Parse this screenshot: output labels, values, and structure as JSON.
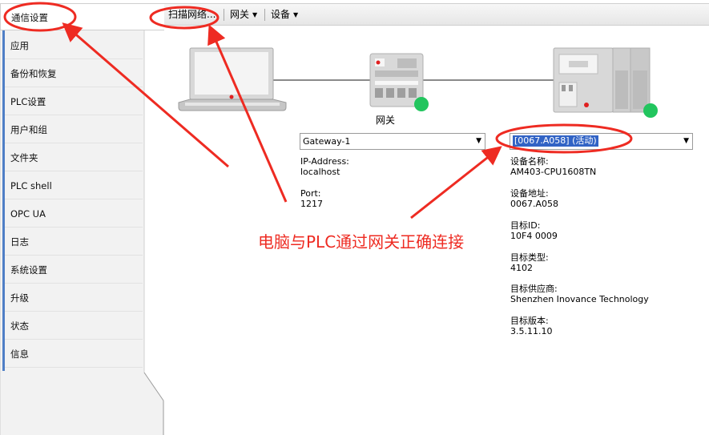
{
  "sidebar": {
    "active": "通信设置",
    "items": [
      "应用",
      "备份和恢复",
      "PLC设置",
      "用户和组",
      "文件夹",
      "PLC shell",
      "OPC UA",
      "日志",
      "系统设置",
      "升级",
      "状态",
      "信息"
    ]
  },
  "toolbar": {
    "scan_label": "扫描网络...",
    "gateway_label": "网关",
    "device_label": "设备"
  },
  "gateway": {
    "label": "网关",
    "select_value": "Gateway-1",
    "ip_label": "IP-Address:",
    "ip_value": "localhost",
    "port_label": "Port:",
    "port_value": "1217",
    "status_color": "#22c55e"
  },
  "device": {
    "select_value": "[0067.A058] (活动)",
    "fields": [
      {
        "label": "设备名称:",
        "value": "AM403-CPU1608TN"
      },
      {
        "label": "设备地址:",
        "value": "0067.A058"
      },
      {
        "label": "目标ID:",
        "value": "10F4  0009"
      },
      {
        "label": "目标类型:",
        "value": "4102"
      },
      {
        "label": "目标供应商:",
        "value": "Shenzhen  Inovance  Technology"
      },
      {
        "label": "目标版本:",
        "value": "3.5.11.10"
      }
    ],
    "status_color": "#22c55e"
  },
  "annotation": {
    "text": "电脑与PLC通过网关正确连接",
    "color": "#ee2b22"
  }
}
